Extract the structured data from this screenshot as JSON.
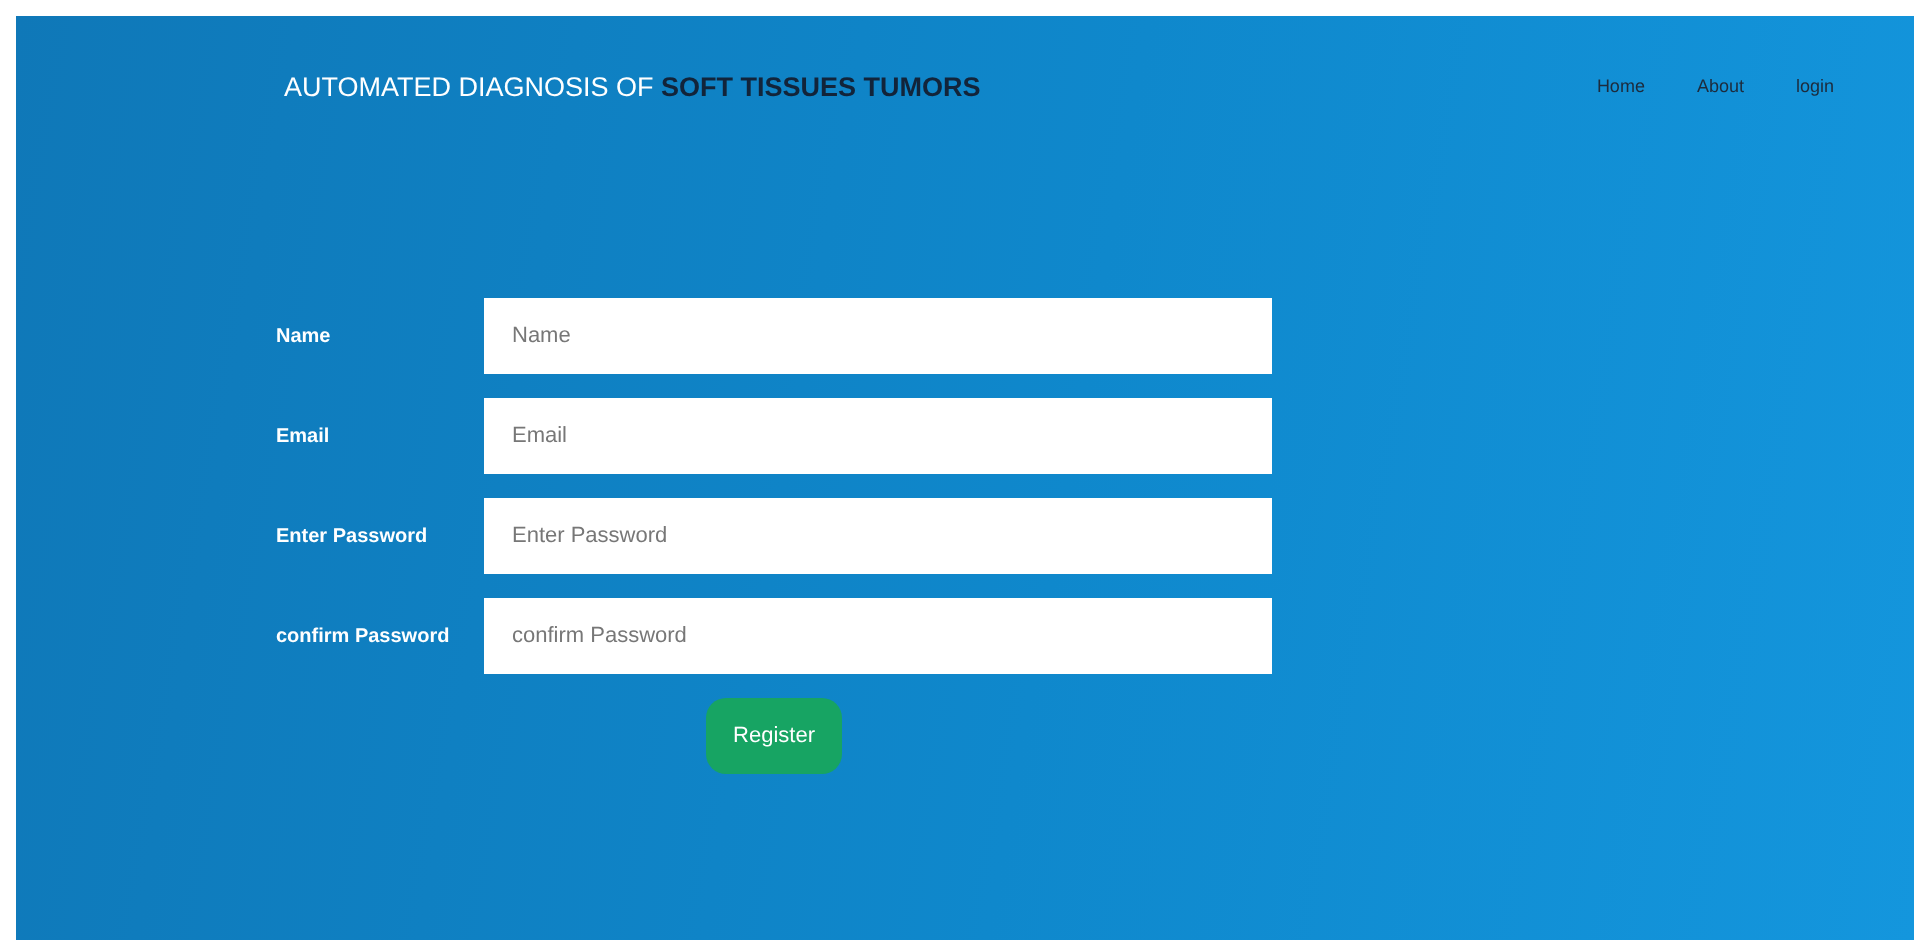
{
  "header": {
    "title": "AUTOMATED DIAGNOSIS OF **SOFT TISSUES TUMORS**",
    "nav": [
      {
        "label": "Home"
      },
      {
        "label": "About"
      },
      {
        "label": "login"
      }
    ]
  },
  "form": {
    "fields": [
      {
        "label": "Name",
        "placeholder": "Name"
      },
      {
        "label": "Email",
        "placeholder": "Email"
      },
      {
        "label": "Enter Password",
        "placeholder": "Enter Password"
      },
      {
        "label": "confirm Password",
        "placeholder": "confirm Password"
      }
    ],
    "submit": "Register"
  }
}
